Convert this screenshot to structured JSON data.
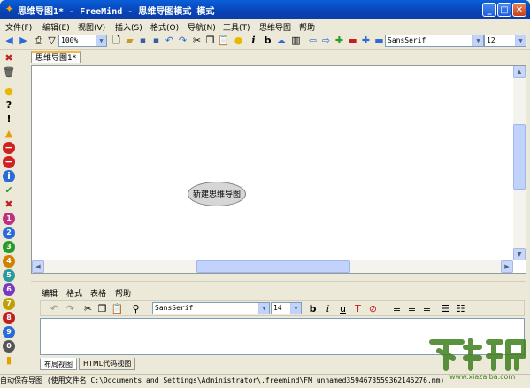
{
  "window": {
    "title": "思维导图1* - FreeMind - 思维导图模式 模式",
    "minimize": "_",
    "maximize": "□",
    "close": "✕"
  },
  "menu": [
    "文件(F)",
    "编辑(E)",
    "视图(V)",
    "插入(S)",
    "格式(O)",
    "导航(N)",
    "工具(T)",
    "思维导图",
    "帮助"
  ],
  "toolbar": {
    "zoom": "100%",
    "font": "SansSerif",
    "font_size": "12"
  },
  "tab": {
    "label": "思维导图1*"
  },
  "map": {
    "root_node": "新建思维导图"
  },
  "editor": {
    "menu": [
      "编辑",
      "格式",
      "表格",
      "帮助"
    ],
    "font": "SansSerif",
    "font_size": "14",
    "bold": "b",
    "italic": "i",
    "underline": "u",
    "bottom_tabs": [
      "布局视图",
      "HTML代码视图"
    ]
  },
  "status": {
    "text": "自动保存导图 (使用文件名 C:\\Documents and Settings\\Administrator\\.freemind\\FM_unnamed3594673559362145276.mm)"
  },
  "watermark": {
    "text": "下载吧",
    "url": "www.xiazaiba.com"
  },
  "colors": {
    "titlebar": "#0842B4",
    "tab_accent": "#F8B840",
    "node_fill": "#D6D6D6"
  }
}
